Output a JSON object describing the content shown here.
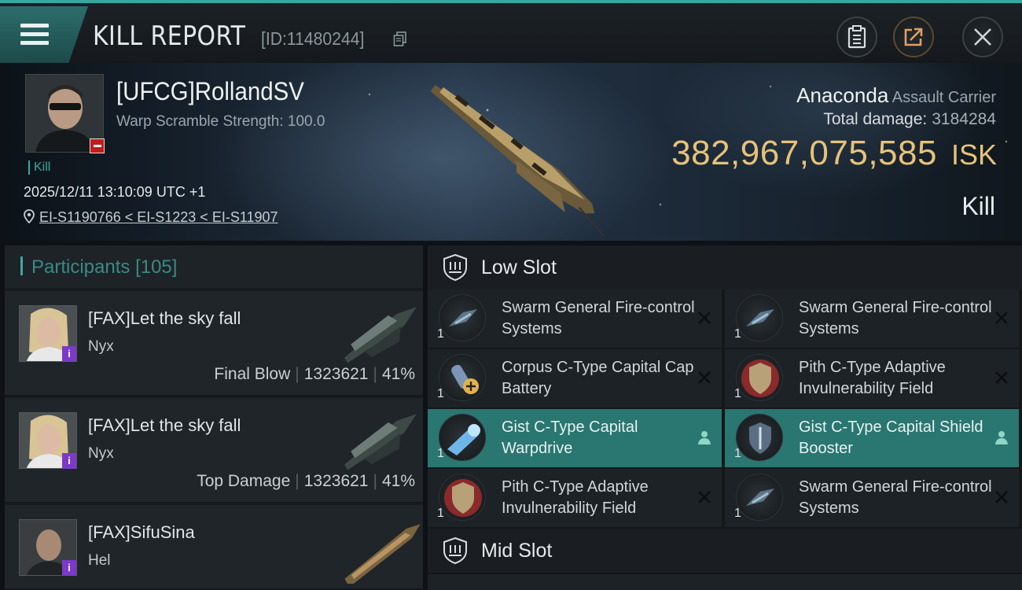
{
  "header": {
    "title": "KILL REPORT",
    "report_id": "[ID:11480244]"
  },
  "victim": {
    "name": "[UFCG]RollandSV",
    "warp_scramble": "Warp Scramble Strength: 100.0",
    "tag": "Kill",
    "datetime": "2025/12/11 13:10:09 UTC +1",
    "location": "EI-S1190766 < EI-S1223 < EI-S11907"
  },
  "ship": {
    "name": "Anaconda",
    "class": "Assault Carrier",
    "total_damage_label": "Total damage:",
    "total_damage": "3184284",
    "isk_value": "382,967,075,585",
    "isk_unit": "ISK",
    "result": "Kill"
  },
  "participants": {
    "label": "Participants",
    "count": "[105]",
    "rows": [
      {
        "name": "[FAX]Let the sky fall",
        "ship": "Nyx",
        "stat_label": "Final Blow",
        "damage": "1323621",
        "percent": "41%",
        "badge": "i"
      },
      {
        "name": "[FAX]Let the sky fall",
        "ship": "Nyx",
        "stat_label": "Top Damage",
        "damage": "1323621",
        "percent": "41%",
        "badge": "i"
      },
      {
        "name": "[FAX]SifuSina",
        "ship": "Hel",
        "badge": "i"
      }
    ]
  },
  "low_slot": {
    "label": "Low Slot",
    "modules": [
      {
        "name": "Swarm General Fire-control Systems",
        "qty": "1",
        "status": "destroyed"
      },
      {
        "name": "Swarm General Fire-control Systems",
        "qty": "1",
        "status": "destroyed"
      },
      {
        "name": "Corpus C-Type Capital Cap Battery",
        "qty": "1",
        "status": "destroyed"
      },
      {
        "name": "Pith C-Type Adaptive Invulnerability Field",
        "qty": "1",
        "status": "destroyed"
      },
      {
        "name": "Gist C-Type Capital Warpdrive",
        "qty": "1",
        "status": "dropped"
      },
      {
        "name": "Gist C-Type Capital Shield Booster",
        "qty": "1",
        "status": "dropped"
      },
      {
        "name": "Pith C-Type Adaptive Invulnerability Field",
        "qty": "1",
        "status": "destroyed"
      },
      {
        "name": "Swarm General Fire-control Systems",
        "qty": "1",
        "status": "destroyed"
      }
    ]
  },
  "mid_slot": {
    "label": "Mid Slot"
  },
  "colors": {
    "accent": "#3aa6a0",
    "isk": "#e6c27a",
    "active_row": "#2a7671",
    "victim_badge": "#c41b1b",
    "participant_badge": "#7c3ac8"
  }
}
